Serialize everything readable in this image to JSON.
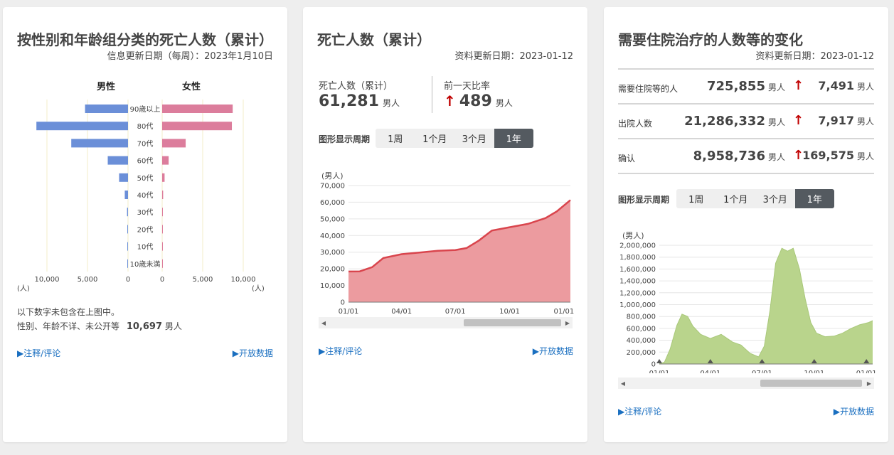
{
  "card1": {
    "title": "按性别和年龄组分类的死亡人数（累计）",
    "update": "信息更新日期（每周）：2023年1月10日",
    "male_label": "男性",
    "female_label": "女性",
    "unit_left": "(人)",
    "unit_right": "(人)",
    "note_line1": "以下数字未包含在上图中。",
    "note_line2": "性别、年龄不详、未公开等",
    "note_value": "10,697",
    "note_unit": "男人",
    "link_notes": "▶注释/评论",
    "link_open": "▶开放数据",
    "colors": {
      "male": "#6b8fd8",
      "female": "#dc7d9c"
    }
  },
  "card2": {
    "title": "死亡人数（累计）",
    "update": "资料更新日期：2023-01-12",
    "stat1_label": "死亡人数（累计）",
    "stat1_value": "61,281",
    "stat1_unit": "男人",
    "stat2_label": "前一天比率",
    "stat2_value": "489",
    "stat2_unit": "男人",
    "period_label": "图形显示周期",
    "periods": [
      "1周",
      "1个月",
      "3个月",
      "1年"
    ],
    "active_period": "1年",
    "link_notes": "▶注释/评论",
    "link_open": "▶开放数据",
    "colors": {
      "line": "#d9454d",
      "fill": "#ec9b9f"
    }
  },
  "card3": {
    "title": "需要住院治疗的人数等的变化",
    "update": "资料更新日期：2023-01-12",
    "rows": [
      {
        "label": "需要住院等的人",
        "value": "725,855",
        "unit": "男人",
        "change": "7,491",
        "change_unit": "男人"
      },
      {
        "label": "出院人数",
        "value": "21,286,332",
        "unit": "男人",
        "change": "7,917",
        "change_unit": "男人"
      },
      {
        "label": "确认",
        "value": "8,958,736",
        "unit": "男人",
        "change": "169,575",
        "change_unit": "男人"
      }
    ],
    "period_label": "图形显示周期",
    "periods": [
      "1周",
      "1个月",
      "3个月",
      "1年"
    ],
    "active_period": "1年",
    "link_notes": "▶注释/评论",
    "link_open": "▶开放数据",
    "colors": {
      "fill": "#b9d48c",
      "line": "#a9c87a"
    }
  },
  "chart_data": [
    {
      "type": "bar",
      "orientation": "horizontal",
      "categories": [
        "90歳以上",
        "80代",
        "70代",
        "60代",
        "50代",
        "40代",
        "30代",
        "20代",
        "10代",
        "10歳未満"
      ],
      "series": [
        {
          "name": "男性",
          "values": [
            5300,
            11300,
            7000,
            2500,
            1100,
            400,
            120,
            40,
            10,
            10
          ]
        },
        {
          "name": "女性",
          "values": [
            8700,
            8600,
            2900,
            800,
            300,
            120,
            50,
            20,
            10,
            10
          ]
        }
      ],
      "xticks": [
        "10,000",
        "5,000",
        "0",
        "0",
        "5,000",
        "10,000"
      ],
      "xlim": [
        0,
        12000
      ]
    },
    {
      "type": "area",
      "ylabel": "(男人)",
      "ylim": [
        0,
        70000
      ],
      "yticks": [
        "70,000",
        "60,000",
        "50,000",
        "40,000",
        "30,000",
        "20,000",
        "10,000",
        "0"
      ],
      "xticks": [
        "01/01",
        "04/01",
        "07/01",
        "10/01",
        "01/01"
      ],
      "x": [
        "2022-01-01",
        "2022-01-20",
        "2022-02-10",
        "2022-03-01",
        "2022-04-01",
        "2022-05-01",
        "2022-06-01",
        "2022-07-01",
        "2022-07-20",
        "2022-08-10",
        "2022-09-01",
        "2022-10-01",
        "2022-11-01",
        "2022-12-01",
        "2022-12-20",
        "2023-01-12"
      ],
      "values": [
        18400,
        18500,
        21000,
        26500,
        28800,
        29800,
        30800,
        31300,
        32500,
        37000,
        43000,
        45000,
        47000,
        50500,
        54500,
        61281
      ]
    },
    {
      "type": "area",
      "ylabel": "(男人)",
      "ylim": [
        0,
        2000000
      ],
      "yticks": [
        "2,000,000",
        "1,800,000",
        "1,600,000",
        "1,400,000",
        "1,200,000",
        "1,000,000",
        "800,000",
        "600,000",
        "400,000",
        "200,000",
        "0"
      ],
      "xticks": [
        "01/01",
        "04/01",
        "07/01",
        "10/01",
        "01/01"
      ],
      "x": [
        "2022-01-01",
        "2022-01-10",
        "2022-01-20",
        "2022-02-01",
        "2022-02-10",
        "2022-02-20",
        "2022-03-01",
        "2022-03-15",
        "2022-04-01",
        "2022-04-20",
        "2022-05-10",
        "2022-05-25",
        "2022-06-10",
        "2022-06-25",
        "2022-07-05",
        "2022-07-15",
        "2022-07-25",
        "2022-08-05",
        "2022-08-15",
        "2022-08-25",
        "2022-09-05",
        "2022-09-15",
        "2022-09-25",
        "2022-10-05",
        "2022-10-20",
        "2022-11-05",
        "2022-11-20",
        "2022-12-05",
        "2022-12-20",
        "2023-01-05",
        "2023-01-12"
      ],
      "values": [
        5000,
        30000,
        250000,
        650000,
        840000,
        800000,
        640000,
        500000,
        430000,
        500000,
        370000,
        320000,
        180000,
        120000,
        300000,
        900000,
        1700000,
        1950000,
        1900000,
        1950000,
        1600000,
        1100000,
        700000,
        520000,
        460000,
        470000,
        520000,
        600000,
        660000,
        700000,
        730000
      ]
    }
  ]
}
